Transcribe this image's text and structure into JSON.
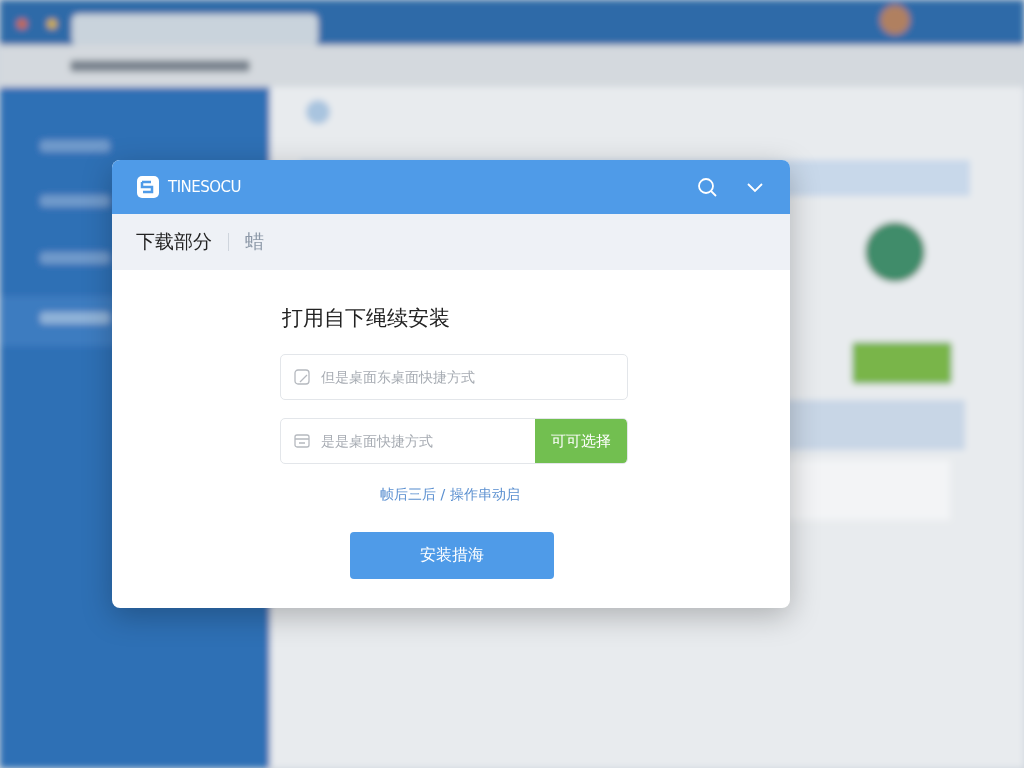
{
  "dialog": {
    "logo_text": "TINESOCU",
    "tabs": [
      {
        "label": "下载部分",
        "selected": true
      },
      {
        "label": "蜡",
        "selected": false
      }
    ],
    "heading": "打用自下绳续安装",
    "fields": [
      {
        "placeholder": "但是桌面东桌面快捷方式"
      },
      {
        "placeholder": "是是桌面快捷方式",
        "button": "可可选择"
      }
    ],
    "link": "帧后三后 / 操作串动启",
    "primary_button": "安装措海"
  }
}
